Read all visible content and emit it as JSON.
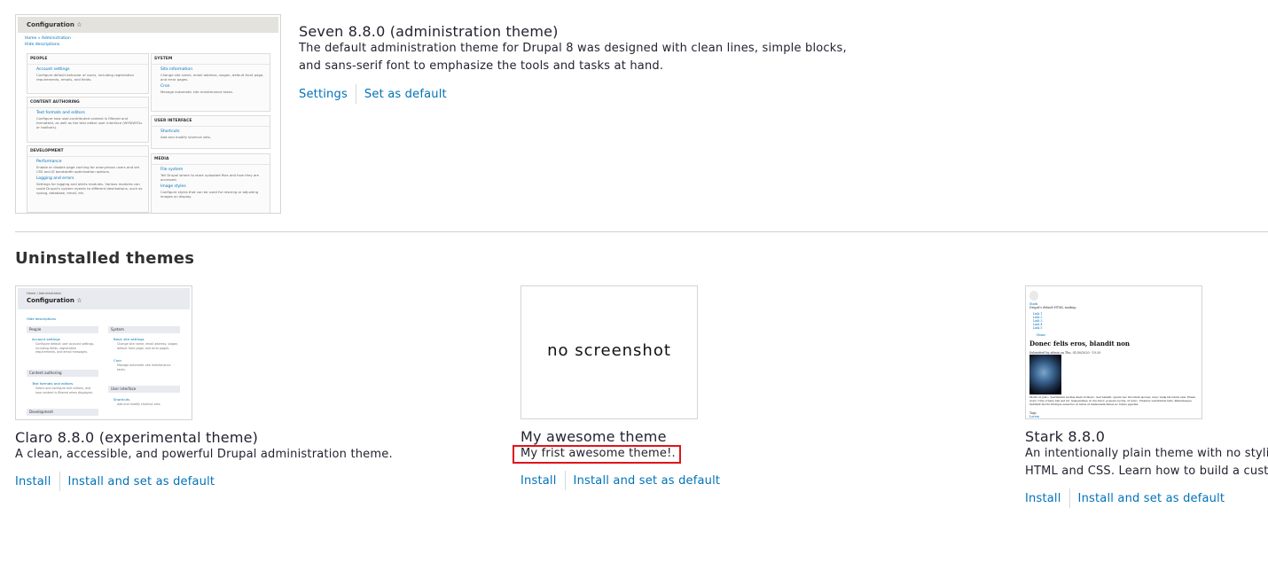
{
  "installed": {
    "seven": {
      "name": "Seven 8.8.0 (administration theme)",
      "description": "The default administration theme for Drupal 8 was designed with clean lines, simple blocks, and sans-serif font to emphasize the tools and tasks at hand.",
      "links": [
        "Settings",
        "Set as default"
      ],
      "preview": {
        "title": "Configuration ☆",
        "breadcrumb": "Home » Administration",
        "hide": "Hide descriptions",
        "left": [
          {
            "heading": "PEOPLE",
            "items": [
              {
                "link": "Account settings",
                "text": "Configure default behavior of users, including registration requirements, emails, and fields."
              }
            ]
          },
          {
            "heading": "CONTENT AUTHORING",
            "items": [
              {
                "link": "Text formats and editors",
                "text": "Configure how user-contributed content is filtered and formatted, as well as the text editor user interface (WYSIWYGs or toolbars)."
              }
            ]
          },
          {
            "heading": "DEVELOPMENT",
            "items": [
              {
                "link": "Performance",
                "text": "Enable or disable page caching for anonymous users and set CSS and JS bandwidth optimization options."
              },
              {
                "link": "Logging and errors",
                "text": "Settings for logging and alerts modules. Various modules can route Drupal's system events to different destinations, such as syslog, database, email, etc."
              }
            ]
          }
        ],
        "right": [
          {
            "heading": "SYSTEM",
            "items": [
              {
                "link": "Site information",
                "text": "Change site name, email address, slogan, default front page, and error pages."
              },
              {
                "link": "Cron",
                "text": "Manage automatic site maintenance tasks."
              }
            ]
          },
          {
            "heading": "USER INTERFACE",
            "items": [
              {
                "link": "Shortcuts",
                "text": "Add and modify shortcut sets."
              }
            ]
          },
          {
            "heading": "MEDIA",
            "items": [
              {
                "link": "File system",
                "text": "Tell Drupal where to store uploaded files and how they are accessed."
              },
              {
                "link": "Image styles",
                "text": "Configure styles that can be used for resizing or adjusting images on display."
              }
            ]
          }
        ]
      }
    }
  },
  "uninstalled_heading": "Uninstalled themes",
  "uninstalled": [
    {
      "name": "Claro 8.8.0 (experimental theme)",
      "description": "A clean, accessible, and powerful Drupal administration theme.",
      "links": [
        "Install",
        "Install and set as default"
      ],
      "preview": {
        "breadcrumb": "Home / Administration",
        "title": "Configuration ☆",
        "hide": "Hide descriptions",
        "people": "People",
        "account": "Account settings",
        "account_text": "Configure default user account settings, including fields, registration requirements, and email messages.",
        "content": "Content authoring",
        "formats": "Text formats and editors",
        "formats_text": "Select and configure text editors, and how content is filtered when displayed.",
        "development": "Development",
        "system": "System",
        "site": "Basic site settings",
        "site_text": "Change site name, email address, slogan, default front page, and error pages.",
        "cron": "Cron",
        "cron_text": "Manage automatic site maintenance tasks.",
        "ui": "User interface",
        "shortcuts": "Shortcuts",
        "shortcuts_text": "Add and modify shortcut sets."
      }
    },
    {
      "name": "My awesome theme",
      "description": "My frist awesome theme!.",
      "links": [
        "Install",
        "Install and set as default"
      ],
      "no_screenshot": "no screenshot"
    },
    {
      "name": "Stark 8.8.0",
      "description": "An intentionally plain theme with no styling to demonstrate default Drupal's HTML and CSS. Learn how to build a custom theme",
      "links": [
        "Install",
        "Install and set as default"
      ],
      "preview": {
        "site": "Stark",
        "slogan": "Drupal's default HTML markup",
        "nav": [
          "Link 1",
          "Link 2",
          "Link 3",
          "Link 4",
          "Link 5"
        ],
        "home": "Home",
        "heading": "Donec felis eros, blandit non",
        "submitted": "Submitted by admin on Thu, 01/30/2020 - 10:20",
        "body": "Morbi id justo. Vestibulum lacinia diam id libero. Sed blandit, ipsum nec tincidunt laoreet, nunc nulla tincidunt erat. Etiam dolor. Cras ornare nisl sed mi. Suspendisse ut dui dolor, posuere lectus, ut nunc. Vivamus vestibulum felis. Pellentesque habitant morbi tristique senectus et netus et malesuada fames ac turpis egestas.",
        "tags": "Tags",
        "tag": "Lorem"
      }
    }
  ]
}
